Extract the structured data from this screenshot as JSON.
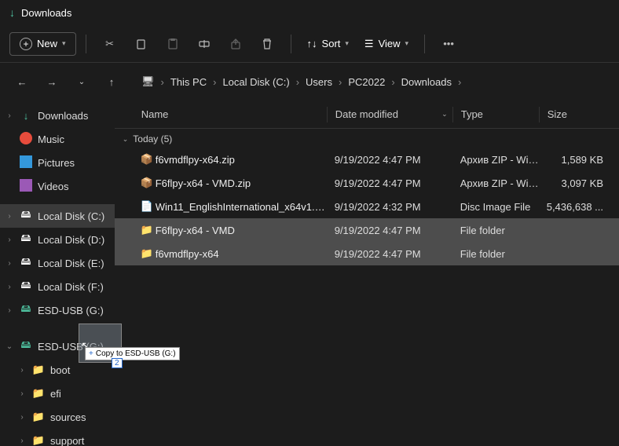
{
  "title": "Downloads",
  "toolbar": {
    "new_label": "New",
    "sort_label": "Sort",
    "view_label": "View"
  },
  "breadcrumb": [
    "This PC",
    "Local Disk (C:)",
    "Users",
    "PC2022",
    "Downloads"
  ],
  "columns": {
    "name": "Name",
    "date": "Date modified",
    "type": "Type",
    "size": "Size"
  },
  "group_label": "Today (5)",
  "files": [
    {
      "icon": "zip",
      "name": "f6vmdflpy-x64.zip",
      "date": "9/19/2022 4:47 PM",
      "type": "Архив ZIP - WinR...",
      "size": "1,589 KB",
      "selected": false
    },
    {
      "icon": "zip",
      "name": "F6flpy-x64 - VMD.zip",
      "date": "9/19/2022 4:47 PM",
      "type": "Архив ZIP - WinR...",
      "size": "3,097 KB",
      "selected": false
    },
    {
      "icon": "iso",
      "name": "Win11_EnglishInternational_x64v1.iso",
      "date": "9/19/2022 4:32 PM",
      "type": "Disc Image File",
      "size": "5,436,638 ...",
      "selected": false
    },
    {
      "icon": "folder",
      "name": "F6flpy-x64 - VMD",
      "date": "9/19/2022 4:47 PM",
      "type": "File folder",
      "size": "",
      "selected": true
    },
    {
      "icon": "folder",
      "name": "f6vmdflpy-x64",
      "date": "9/19/2022 4:47 PM",
      "type": "File folder",
      "size": "",
      "selected": true
    }
  ],
  "sidebar": {
    "top": [
      {
        "icon": "downloads",
        "label": "Downloads"
      },
      {
        "icon": "music",
        "label": "Music"
      },
      {
        "icon": "pictures",
        "label": "Pictures"
      },
      {
        "icon": "videos",
        "label": "Videos"
      }
    ],
    "drives": [
      {
        "label": "Local Disk (C:)",
        "selected": true
      },
      {
        "label": "Local Disk (D:)"
      },
      {
        "label": "Local Disk (E:)"
      },
      {
        "label": "Local Disk (F:)"
      },
      {
        "label": "ESD-USB (G:)",
        "usb": true
      }
    ],
    "expanded_drive": "ESD-USB (G:)",
    "children": [
      "boot",
      "efi",
      "sources",
      "support"
    ]
  },
  "drag": {
    "tooltip": "Copy to ESD-USB (G:)",
    "count": "2"
  }
}
